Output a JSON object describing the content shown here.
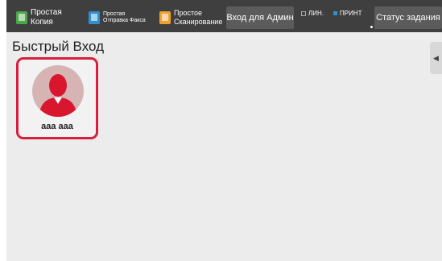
{
  "topbar": {
    "apps": [
      {
        "label_line1": "Простая",
        "label_line2": "Копия",
        "icon": "copy-icon",
        "color": "#4aa84a"
      },
      {
        "label_line1": "Простая",
        "label_line2": "Отправка Факса",
        "icon": "fax-icon",
        "color": "#2f8fd0"
      },
      {
        "label_line1": "Простое",
        "label_line2": "Сканирование",
        "icon": "scan-icon",
        "color": "#f0a030"
      }
    ],
    "admin_login_label": "Вход для Админ",
    "indicator_line": "ЛИН.",
    "indicator_print": "ПРИНТ",
    "job_status_label": "Статус задания"
  },
  "main": {
    "title": "Быстрый Вход",
    "users": [
      {
        "name": "aaa aaa",
        "avatar_icon": "user-avatar-icon"
      }
    ],
    "side_tab_icon": "side-tab-arrow-icon"
  },
  "colors": {
    "accent_frame": "#d6203c",
    "topbar_bg": "#3f3f3f",
    "content_bg": "#ececec"
  }
}
